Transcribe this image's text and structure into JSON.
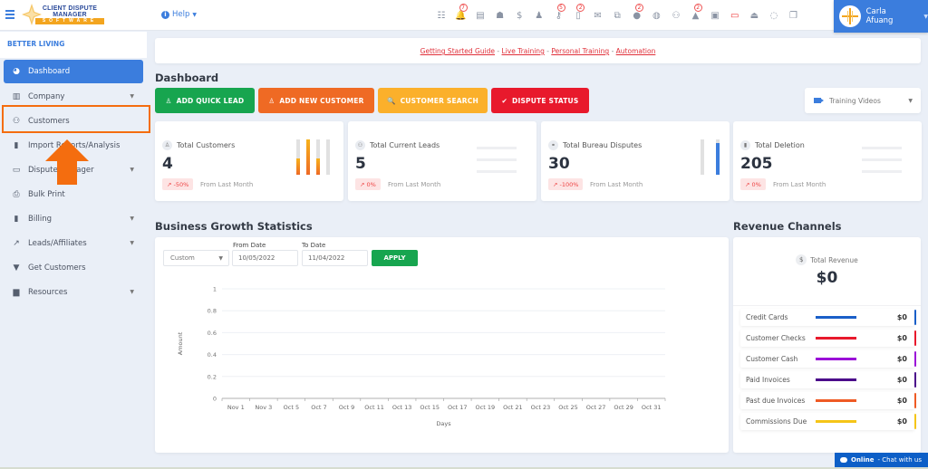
{
  "topbar": {
    "logo": {
      "line1": "CLIENT DISPUTE",
      "line2": "MANAGER",
      "line3": "SOFTWARE"
    },
    "help_label": "Help",
    "icons": [
      {
        "name": "tasks-icon",
        "glyph": "☷",
        "badge": null
      },
      {
        "name": "bell-icon",
        "glyph": "🔔",
        "badge": "7"
      },
      {
        "name": "id-card-icon",
        "glyph": "▤",
        "badge": null
      },
      {
        "name": "agent-icon",
        "glyph": "☗",
        "badge": null
      },
      {
        "name": "dollar-icon",
        "glyph": "$",
        "badge": null
      },
      {
        "name": "user-tie-icon",
        "glyph": "♟",
        "badge": null
      },
      {
        "name": "key-icon",
        "glyph": "⚷",
        "badge": "5"
      },
      {
        "name": "document-icon",
        "glyph": "▯",
        "badge": "2"
      },
      {
        "name": "envelope-icon",
        "glyph": "✉",
        "badge": null
      },
      {
        "name": "sitemap-icon",
        "glyph": "⧉",
        "badge": null
      },
      {
        "name": "info-icon",
        "glyph": "●",
        "badge": "2"
      },
      {
        "name": "globe-icon",
        "glyph": "◍",
        "badge": null
      },
      {
        "name": "users-icon",
        "glyph": "⚇",
        "badge": null
      },
      {
        "name": "warning-icon",
        "glyph": "▲",
        "badge": "2"
      },
      {
        "name": "inbox-calendar-icon",
        "glyph": "▣",
        "badge": null
      },
      {
        "name": "money-icon",
        "glyph": "▭",
        "badge": null
      },
      {
        "name": "tray-icon",
        "glyph": "⏏",
        "badge": null
      },
      {
        "name": "chat-icon",
        "glyph": "◌",
        "badge": null
      },
      {
        "name": "copy-icon",
        "glyph": "❐",
        "badge": null
      }
    ],
    "user_name": "Carla Afuang"
  },
  "sidebar": {
    "org_name": "BETTER LIVING",
    "items": [
      {
        "label": "Dashboard",
        "icon": "◕",
        "icon_name": "chart-pie-icon",
        "active": true,
        "dropdown": false
      },
      {
        "label": "Company",
        "icon": "▥",
        "icon_name": "building-icon",
        "active": false,
        "dropdown": true
      },
      {
        "label": "Customers",
        "icon": "⚇",
        "icon_name": "users-icon",
        "active": false,
        "dropdown": false
      },
      {
        "label": "Import Reports/Analysis",
        "icon": "▮",
        "icon_name": "file-import-icon",
        "active": false,
        "dropdown": false
      },
      {
        "label": "Dispute Manager",
        "icon": "▭",
        "icon_name": "laptop-icon",
        "active": false,
        "dropdown": true
      },
      {
        "label": "Bulk Print",
        "icon": "⎙",
        "icon_name": "print-icon",
        "active": false,
        "dropdown": false
      },
      {
        "label": "Billing",
        "icon": "▮",
        "icon_name": "invoice-icon",
        "active": false,
        "dropdown": true
      },
      {
        "label": "Leads/Affiliates",
        "icon": "↗",
        "icon_name": "chart-line-icon",
        "active": false,
        "dropdown": true
      },
      {
        "label": "Get Customers",
        "icon": "▼",
        "icon_name": "graduation-cap-icon",
        "active": false,
        "dropdown": false
      },
      {
        "label": "Resources",
        "icon": "▆",
        "icon_name": "book-reader-icon",
        "active": false,
        "dropdown": true
      }
    ]
  },
  "links": [
    {
      "label": "Getting Started Guide"
    },
    {
      "label": "Live Training"
    },
    {
      "label": "Personal Training"
    },
    {
      "label": "Automation"
    }
  ],
  "link_separator": " - ",
  "dashboard": {
    "title": "Dashboard",
    "buttons": [
      {
        "label": "ADD QUICK LEAD",
        "icon": "♙",
        "color": "#17a54f"
      },
      {
        "label": "ADD NEW CUSTOMER",
        "icon": "♙",
        "color": "#ef6a24"
      },
      {
        "label": "CUSTOMER SEARCH",
        "icon": "🔍",
        "color": "#fbb02b"
      },
      {
        "label": "DISPUTE STATUS",
        "icon": "✔",
        "color": "#e8192c"
      }
    ],
    "training_videos": "Training Videos"
  },
  "stats": [
    {
      "label": "Total Customers",
      "value": "4",
      "change": "-50%",
      "from": "From Last Month",
      "icon": "♙",
      "mini_bars": [
        0.45,
        1.0,
        0.45,
        0.0
      ]
    },
    {
      "label": "Total Current Leads",
      "value": "5",
      "change": "0%",
      "from": "From Last Month",
      "icon": "⚇"
    },
    {
      "label": "Total Bureau Disputes",
      "value": "30",
      "change": "-100%",
      "from": "From Last Month",
      "icon": "⚭",
      "mini_bars": [
        0.0,
        0.9
      ]
    },
    {
      "label": "Total Deletion",
      "value": "205",
      "change": "0%",
      "from": "From Last Month",
      "icon": "▮"
    }
  ],
  "growth": {
    "title": "Business Growth Statistics",
    "range_select": "Custom",
    "from_label": "From Date",
    "from_value": "10/05/2022",
    "to_label": "To Date",
    "to_value": "11/04/2022",
    "apply_label": "APPLY"
  },
  "chart_data": {
    "type": "line",
    "title": "",
    "xlabel": "Days",
    "ylabel": "Amount",
    "categories": [
      "Nov 1",
      "Nov 3",
      "Oct 5",
      "Oct 7",
      "Oct 9",
      "Oct 11",
      "Oct 13",
      "Oct 15",
      "Oct 17",
      "Oct 19",
      "Oct 21",
      "Oct 23",
      "Oct 25",
      "Oct 27",
      "Oct 29",
      "Oct 31"
    ],
    "yticks": [
      "0",
      "0.2",
      "0.4",
      "0.6",
      "0.8",
      "1"
    ],
    "ylim": [
      0,
      1
    ],
    "series": [],
    "grid": true
  },
  "revenue": {
    "title": "Revenue Channels",
    "total_label": "Total Revenue",
    "total_value": "$0",
    "channels": [
      {
        "label": "Credit Cards",
        "value": "$0",
        "color": "#1a5fc8"
      },
      {
        "label": "Customer Checks",
        "value": "$0",
        "color": "#e8192c"
      },
      {
        "label": "Customer Cash",
        "value": "$0",
        "color": "#9b10d8"
      },
      {
        "label": "Paid Invoices",
        "value": "$0",
        "color": "#4b0b8a"
      },
      {
        "label": "Past due Invoices",
        "value": "$0",
        "color": "#ef5a24"
      },
      {
        "label": "Commissions Due",
        "value": "$0",
        "color": "#f5c518"
      }
    ]
  },
  "chat_widget": {
    "status": "Online",
    "text": " - Chat with us"
  }
}
